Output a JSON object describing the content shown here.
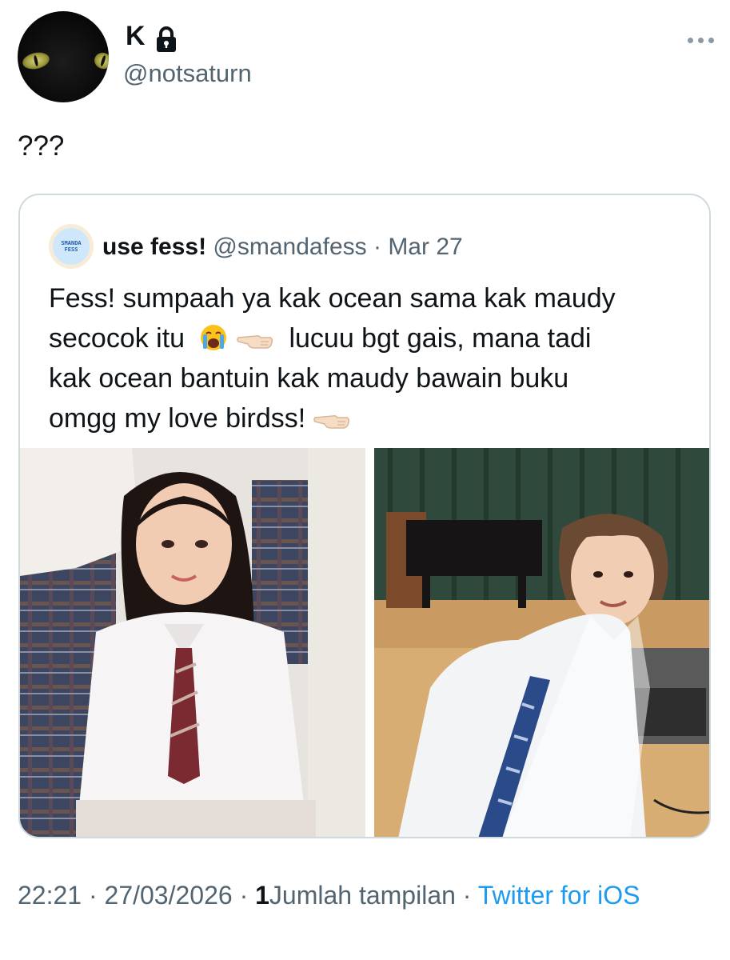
{
  "author": {
    "display_name": "K",
    "handle": "@notsaturn",
    "avatar_icon": "black-cat-avatar",
    "protected_icon": "lock-icon"
  },
  "tweet": {
    "text": "???"
  },
  "quoted_tweet": {
    "display_name": "use fess!",
    "handle": "@smandafess",
    "separator": "·",
    "date": "Mar 27",
    "avatar_text": [
      "SMANDA",
      "FESS"
    ],
    "body_lines": [
      "Fess! sumpaah ya kak ocean sama kak maudy",
      "secocok itu",
      "lucuu bgt gais, mana tadi",
      "kak ocean bantuin kak maudy bawain buku",
      "omgg my love birdss!"
    ],
    "emojis": [
      "loudly-crying-face",
      "backhand-index-pointing-left",
      "backhand-index-pointing-left"
    ],
    "media": [
      "photo-girl-school-uniform",
      "photo-boy-school-uniform"
    ]
  },
  "footer": {
    "time": "22:21",
    "sep1": "·",
    "date": "27/03/2026",
    "sep2": "·",
    "views_count": "1",
    "views_label": "Jumlah tampilan",
    "sep3": "·",
    "source": "Twitter for iOS"
  },
  "colors": {
    "text": "#0f1419",
    "secondary": "#536471",
    "link": "#1d9bf0",
    "border": "#cfd9de"
  }
}
